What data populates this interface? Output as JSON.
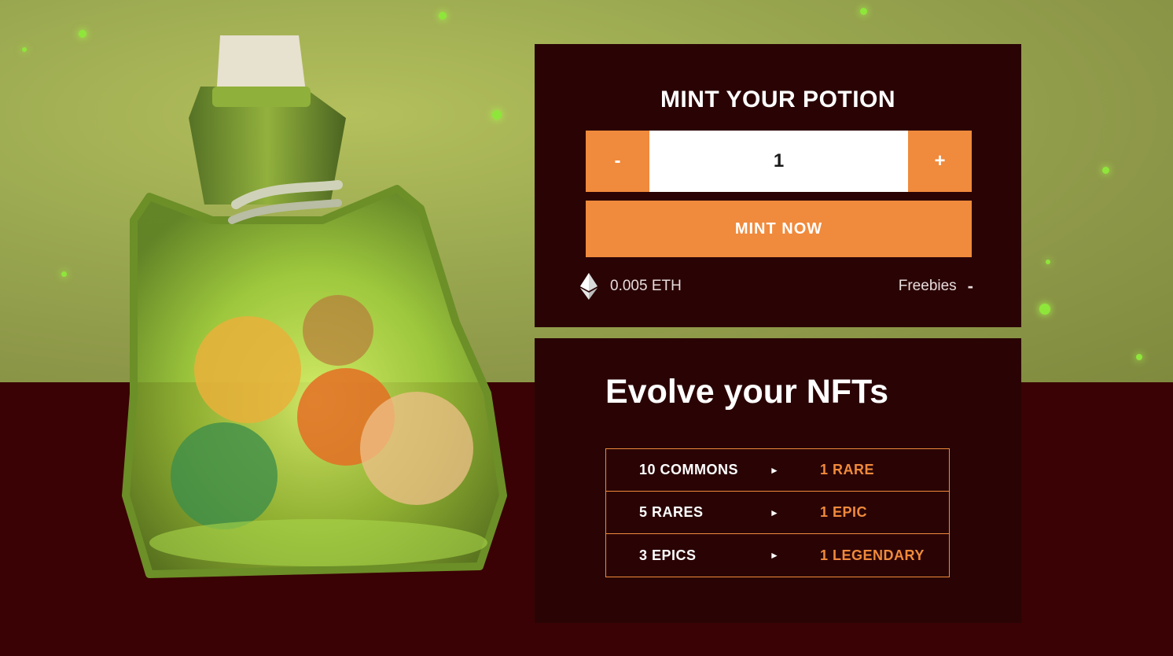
{
  "mint": {
    "title": "MINT YOUR POTION",
    "decrement_label": "-",
    "increment_label": "+",
    "quantity": "1",
    "button_label": "MINT NOW",
    "price": "0.005 ETH",
    "freebies_label": "Freebies",
    "freebies_value": "-"
  },
  "evolve": {
    "title": "Evolve your NFTs",
    "rows": [
      {
        "from": "10 COMMONS",
        "arrow": "►",
        "to": "1 RARE"
      },
      {
        "from": "5 RARES",
        "arrow": "►",
        "to": "1 EPIC"
      },
      {
        "from": "3 EPICS",
        "arrow": "►",
        "to": "1 LEGENDARY"
      }
    ]
  },
  "colors": {
    "accent": "#f08a3c",
    "panel": "#2a0405",
    "floor": "#3a0204",
    "wall": "#9aa850"
  },
  "icons": {
    "currency": "ethereum-icon",
    "illustration": "potion-bottle-icon"
  }
}
